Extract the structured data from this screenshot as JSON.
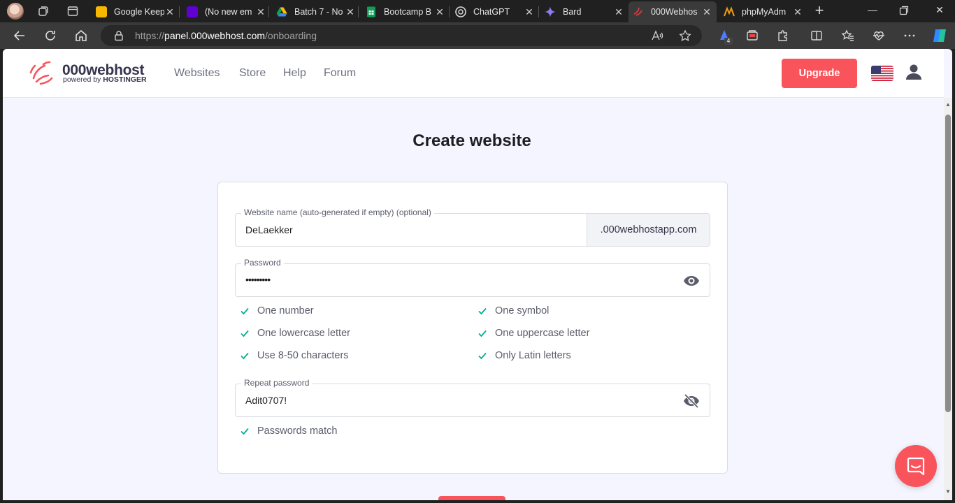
{
  "browser": {
    "tabs": [
      {
        "title": "Google Keep",
        "favicon": "google-keep-icon",
        "color": "#f6b900"
      },
      {
        "title": "(No new em",
        "favicon": "yahoo-mail-icon",
        "color": "#6001d2"
      },
      {
        "title": "Batch 7 - No",
        "favicon": "google-drive-icon",
        "color": "#1fa463"
      },
      {
        "title": "Bootcamp B",
        "favicon": "google-sheets-icon",
        "color": "#0f9d58"
      },
      {
        "title": "ChatGPT",
        "favicon": "chatgpt-icon",
        "color": "#74aa9c"
      },
      {
        "title": "Bard",
        "favicon": "bard-icon",
        "color": "#8e7cf0"
      },
      {
        "title": "000Webhos",
        "favicon": "000webhost-icon",
        "color": "#d0393e",
        "active": true
      },
      {
        "title": "phpMyAdm",
        "favicon": "phpmyadmin-icon",
        "color": "#f39c12"
      }
    ],
    "url": {
      "scheme": "https://",
      "host": "panel.000webhost.com",
      "path": "/onboarding"
    },
    "extension_badge": "4"
  },
  "site": {
    "logo": {
      "name": "000webhost",
      "tagline_prefix": "powered by",
      "tagline_brand": "HOSTINGER"
    },
    "nav": [
      "Websites",
      "Store",
      "Help",
      "Forum"
    ],
    "upgrade_label": "Upgrade",
    "brand_color": "#f9545b"
  },
  "form": {
    "title": "Create website",
    "website_name": {
      "label": "Website name (auto-generated if empty) (optional)",
      "value": "DeLaekker",
      "suffix": ".000webhostapp.com"
    },
    "password": {
      "label": "Password",
      "value": "•••••••••"
    },
    "rules": [
      {
        "text": "One number",
        "met": true
      },
      {
        "text": "One symbol",
        "met": true
      },
      {
        "text": "One lowercase letter",
        "met": true
      },
      {
        "text": "One uppercase letter",
        "met": true
      },
      {
        "text": "Use 8-50 characters",
        "met": true
      },
      {
        "text": "Only Latin letters",
        "met": true
      }
    ],
    "repeat_password": {
      "label": "Repeat password",
      "value": "Adit0707!"
    },
    "match_rule": {
      "text": "Passwords match",
      "met": true
    },
    "check_color": "#00b090"
  }
}
